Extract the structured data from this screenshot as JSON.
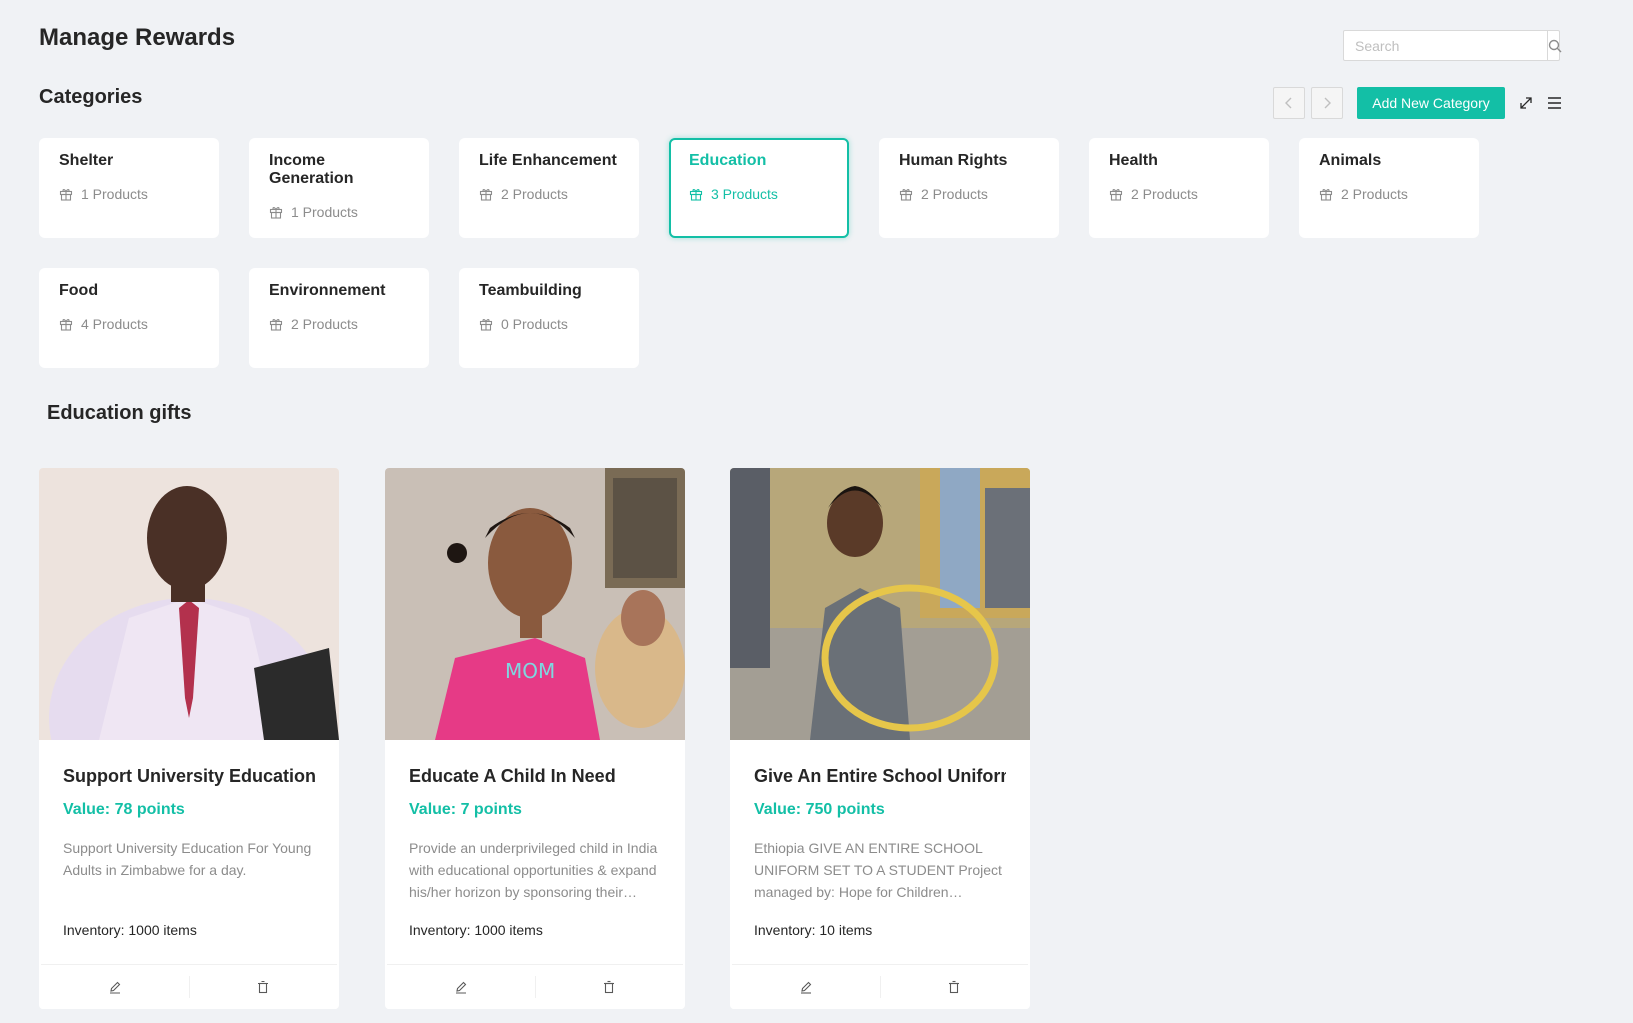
{
  "page": {
    "title": "Manage Rewards"
  },
  "search": {
    "placeholder": "Search"
  },
  "categories_section": {
    "title": "Categories",
    "add_button_label": "Add New Category",
    "items": [
      {
        "name": "Shelter",
        "count": "1 Products",
        "selected": false
      },
      {
        "name": "Income Generation",
        "count": "1 Products",
        "selected": false
      },
      {
        "name": "Life Enhancement",
        "count": "2 Products",
        "selected": false
      },
      {
        "name": "Education",
        "count": "3 Products",
        "selected": true
      },
      {
        "name": "Human Rights",
        "count": "2 Products",
        "selected": false
      },
      {
        "name": "Health",
        "count": "2 Products",
        "selected": false
      },
      {
        "name": "Animals",
        "count": "2 Products",
        "selected": false
      },
      {
        "name": "Food",
        "count": "4 Products",
        "selected": false
      },
      {
        "name": "Environnement",
        "count": "2 Products",
        "selected": false
      },
      {
        "name": "Teambuilding",
        "count": "0 Products",
        "selected": false
      }
    ]
  },
  "gifts_section": {
    "title": "Education gifts",
    "products": [
      {
        "name": "Support University Education For Young Adults in Zimbabwe",
        "value": "Value: 78 points",
        "description": "Support University Education For Young Adults in Zimbabwe for a day.",
        "inventory": "Inventory: 1000 items"
      },
      {
        "name": "Educate A Child In Need",
        "value": "Value: 7 points",
        "description": "Provide an underprivileged child in India with educational opportunities & expand his/her horizon by sponsoring their…",
        "inventory": "Inventory: 1000 items"
      },
      {
        "name": "Give An Entire School Uniform Set",
        "value": "Value: 750 points",
        "description": "Ethiopia GIVE AN ENTIRE SCHOOL UNIFORM SET TO A STUDENT Project managed by: Hope for Children…",
        "inventory": "Inventory: 10 items"
      }
    ]
  },
  "colors": {
    "accent": "#13bfa6",
    "background": "#f0f2f5",
    "card": "#ffffff"
  },
  "icons": [
    "search-icon",
    "chevron-left-icon",
    "chevron-right-icon",
    "expand-icon",
    "menu-icon",
    "gift-icon",
    "edit-icon",
    "delete-icon"
  ]
}
